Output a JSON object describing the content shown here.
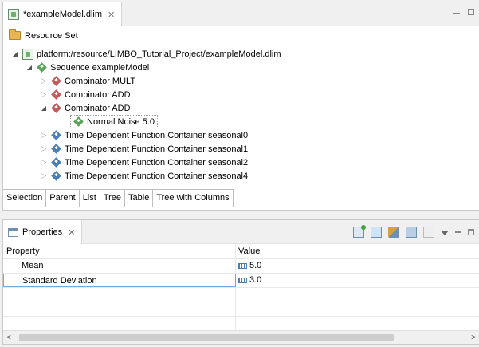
{
  "editor": {
    "tab_title": "*exampleModel.dlim",
    "tab_close": "✕",
    "resource_set": "Resource Set",
    "tree": [
      {
        "label": "platform:/resource/LIMBO_Tutorial_Project/exampleModel.dlim",
        "icon": "file-icon",
        "twisty": "open"
      },
      {
        "label": "Sequence exampleModel",
        "icon": "sequence-icon",
        "twisty": "open"
      },
      {
        "label": "Combinator MULT",
        "icon": "combinator-icon",
        "twisty": "closed"
      },
      {
        "label": "Combinator ADD",
        "icon": "combinator-icon",
        "twisty": "closed"
      },
      {
        "label": "Combinator ADD",
        "icon": "combinator-icon",
        "twisty": "open"
      },
      {
        "label": "Normal Noise 5.0",
        "icon": "noise-icon",
        "twisty": "none"
      },
      {
        "label": "Time Dependent Function Container seasonal0",
        "icon": "container-icon",
        "twisty": "closed"
      },
      {
        "label": "Time Dependent Function Container seasonal1",
        "icon": "container-icon",
        "twisty": "closed"
      },
      {
        "label": "Time Dependent Function Container seasonal2",
        "icon": "container-icon",
        "twisty": "closed"
      },
      {
        "label": "Time Dependent Function Container seasonal4",
        "icon": "container-icon",
        "twisty": "closed"
      }
    ],
    "bottom_tabs": [
      "Selection",
      "Parent",
      "List",
      "Tree",
      "Table",
      "Tree with Columns"
    ]
  },
  "properties": {
    "tab_title": "Properties",
    "tab_close": "✕",
    "col_property": "Property",
    "col_value": "Value",
    "rows": [
      {
        "property": "Mean",
        "value": "5.0"
      },
      {
        "property": "Standard Deviation",
        "value": "3.0"
      }
    ]
  },
  "colors": {
    "selection_border": "#7aa6d6",
    "tree_green": "#5aa55a",
    "tree_red": "#c65a5a",
    "tree_blue": "#4a7fb5"
  }
}
